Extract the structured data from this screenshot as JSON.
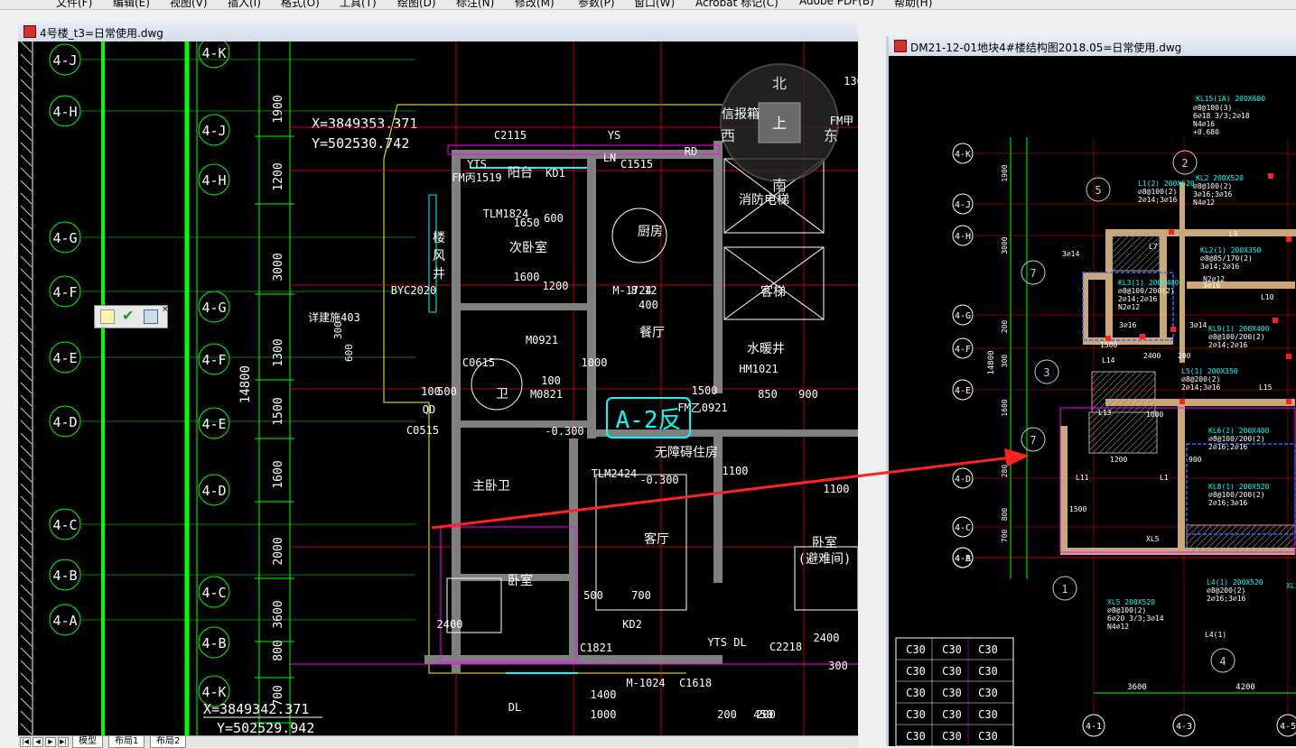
{
  "menu": [
    "文件(F)",
    "编辑(E)",
    "视图(V)",
    "插入(I)",
    "格式(O)",
    "工具(T)",
    "绘图(D)",
    "标注(N)",
    "修改(M)",
    "参数(P)",
    "窗口(W)",
    "Acrobat 标记(C)",
    "Adobe PDF(B)",
    "帮助(H)"
  ],
  "left_window": {
    "title": "4号楼_t3=日常使用.dwg",
    "layout_tabs": [
      "模型",
      "布局1",
      "布局2"
    ],
    "coord_top": {
      "x": "X=3849353.371",
      "y": "Y=502530.742"
    },
    "coord_bottom": {
      "x": "X=3849342.371",
      "y": "Y=502529.942"
    },
    "axis_labels_far": [
      "4-J",
      "4-H",
      "4-G",
      "4-F",
      "4-E",
      "4-D",
      "4-C",
      "4-B",
      "4-A"
    ],
    "axis_labels_near": [
      "4-K",
      "4-J",
      "4-H",
      "4-G",
      "4-F",
      "4-E",
      "4-D",
      "4-C",
      "4-B",
      "4-K"
    ],
    "dims_vertical": [
      "1900",
      "1200",
      "3000",
      "1300",
      "1500",
      "1600",
      "2000",
      "3600",
      "800",
      "700",
      "14800",
      "300",
      "600"
    ],
    "unit_label": "A-2反",
    "room_labels": [
      "阳台",
      "厨房",
      "客厅",
      "卫",
      "主卧卫",
      "卧室",
      "餐厅",
      "无障碍住房",
      "消防电梯",
      "客梯",
      "水暖井",
      "卧室",
      "(避难间)",
      "次卧室",
      "楼",
      "风",
      "井",
      "信报箱"
    ],
    "misc_labels": [
      "C2115",
      "YS",
      "LN",
      "RD",
      "C1515",
      "KD1",
      "TLM1824",
      "1650",
      "1600",
      "8.12",
      "M-1724",
      "BYC2020",
      "详建施403",
      "M0921",
      "C0615",
      "C0515",
      "QD",
      "M0821",
      "-0.300",
      "TLM2424",
      "KD2",
      "C1821",
      "M-1024",
      "C1618",
      "C2218",
      "DL",
      "YTS",
      "FM丙1519",
      "HM1021",
      "FM乙0921",
      "1100",
      "2400",
      "700",
      "500",
      "100",
      "1000",
      "200",
      "450",
      "1500",
      "850",
      "900",
      "1200",
      "400",
      "1400",
      "1000",
      "200",
      "500",
      "100",
      "600",
      "-0.300",
      "FM甲",
      "YTS DL",
      "2400",
      "1100",
      "300",
      "130",
      "1.25"
    ],
    "compass": {
      "n": "北",
      "s": "南",
      "e": "东",
      "w": "西",
      "center": "上"
    }
  },
  "toolbar_popup": {
    "icons": [
      "note-icon",
      "check-icon",
      "layer-icon"
    ]
  },
  "right_window": {
    "title": "DM21-12-01地块4#楼结构图2018.05=日常使用.dwg",
    "axis_labels_left": [
      "4-K",
      "4-J",
      "4-H",
      "4-G",
      "4-F",
      "4-E",
      "4-D",
      "4-C",
      "4-B",
      "4-A"
    ],
    "axis_labels_bottom": [
      "4-1",
      "4-3",
      "4-5"
    ],
    "dims_bottom": [
      "3600",
      "4200"
    ],
    "dims_vertical": [
      "1900",
      "3000",
      "200",
      "300",
      "1600",
      "280",
      "800",
      "700",
      "14800"
    ],
    "beam_notes": [
      "KL15(1A) 200X600",
      "⌀8@100(3)",
      "6⌀18 3/3;2⌀18",
      "N4⌀16",
      "+0.680",
      "KL2 200X520",
      "⌀8@100(2)",
      "3⌀16;3⌀16",
      "N4⌀12",
      "L1(2) 200X520",
      "⌀8@100(2)",
      "2⌀14;3⌀16",
      "KL2(1) 200X350",
      "⌀8@85/170(2)",
      "3⌀14;2⌀16",
      "KL3(1) 200X400",
      "⌀8@100/200(2)",
      "2⌀14;2⌀16",
      "N2⌀12",
      "KL9(1) 200X400",
      "⌀8@100/200(2)",
      "2⌀14;2⌀16",
      "L5(1) 200X350",
      "⌀8@200(2)",
      "2⌀14;3⌀16",
      "KL6(2) 200X400",
      "⌀8@100/200(2)",
      "2⌀16;2⌀16",
      "KL8(1) 200X520",
      "⌀8@100/200(2)",
      "2⌀16;3⌀16",
      "L4(1) 200X520",
      "⌀8@200(2)",
      "2⌀16;3⌀16",
      "XL5 200X520",
      "⌀8@100(2)",
      "6⌀20 3/3;3⌀14",
      "N4⌀12",
      "L4(1)",
      "L7",
      "L9",
      "L13",
      "L14",
      "L15",
      "L10",
      "L11",
      "L1",
      "XL5",
      "XL1 200X520",
      "3⌀14",
      "3⌀16",
      "3⌀14",
      "3⌀16",
      "N2⌀12",
      "1000",
      "1500",
      "2400",
      "1200",
      "900",
      "1500",
      "200",
      "1000"
    ],
    "circle_labels": [
      "5",
      "2",
      "7",
      "3",
      "7",
      "1",
      "4"
    ],
    "concrete_table": [
      "C30",
      "C30",
      "C30",
      "C30",
      "C30",
      "C30",
      "C30",
      "C30",
      "C30",
      "C30",
      "C30",
      "C30",
      "C30",
      "C30",
      "C30",
      "C30",
      "C30",
      "C30"
    ]
  },
  "colors": {
    "cad_bg": "#000000",
    "axis_green": "#00ff00",
    "wall_gray": "#808080",
    "red_line": "#ff0000",
    "cyan": "#00ffff",
    "magenta": "#ff00ff",
    "yellow": "#ffff00",
    "white": "#ffffff",
    "arrow_red": "#ff2222"
  }
}
